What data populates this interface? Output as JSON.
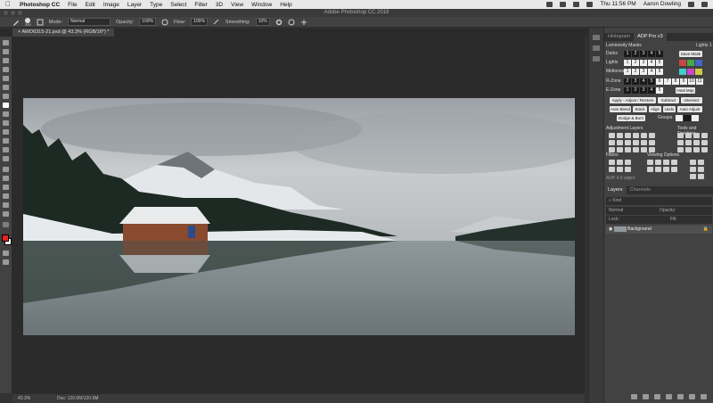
{
  "menubar": {
    "items": [
      "Photoshop CC",
      "File",
      "Edit",
      "Image",
      "Layer",
      "Type",
      "Select",
      "Filter",
      "3D",
      "View",
      "Window",
      "Help"
    ],
    "clock": "Thu 11:56 PM",
    "user": "Aaron Dowling"
  },
  "window": {
    "title": "Adobe Photoshop CC 2018"
  },
  "options": {
    "brush_size": "300",
    "mode_label": "Mode:",
    "mode_value": "Normal",
    "opacity_label": "Opacity:",
    "opacity_value": "100%",
    "flow_label": "Flow:",
    "flow_value": "100%",
    "smoothing_label": "Smoothing:",
    "smoothing_value": "10%"
  },
  "document": {
    "tab": "AWD6315-21.psd @ 43.3% (RGB/16*) *",
    "zoom": "43.3%",
    "doc_info": "Doc: 120.5M/120.5M"
  },
  "panels": {
    "top_tabs": [
      "Histogram",
      "ADP Pro v3"
    ],
    "luminosity_title": "Luminosity Masks",
    "lights_label": "Lights 1",
    "rows": [
      {
        "label": "Darks",
        "nums": [
          "1",
          "2",
          "3",
          "4",
          "5"
        ]
      },
      {
        "label": "Lights",
        "nums": [
          "1",
          "2",
          "3",
          "4",
          "5"
        ]
      },
      {
        "label": "Midtones",
        "nums": [
          "1",
          "2",
          "3",
          "4",
          "5"
        ]
      },
      {
        "label": "R-Zone",
        "nums": [
          "2",
          "3",
          "4",
          "5",
          "6",
          "7",
          "8",
          "9",
          "10",
          "11"
        ]
      },
      {
        "label": "E-Zone",
        "nums": [
          "1",
          "2",
          "3",
          "4",
          "5"
        ]
      }
    ],
    "save_mask": "Save Mask",
    "heal_map": "Heal Map",
    "apply_row": [
      "Apply - Adjust / Restore",
      "Subtract",
      "Intersect"
    ],
    "blend_row": [
      "Auto Blend",
      "Stack",
      "Align",
      "Undo",
      "Auto Adjust"
    ],
    "dodge_burn": "Dodge & Burn",
    "groups": "Groups",
    "adjustment_layers": "Adjustment Layers",
    "tools_finishing": "Tools and Finishing",
    "filters": "Filters",
    "viewing_options": "Viewing Options",
    "adp_footer": "ADP 4.0 adpro",
    "layers_tabs": [
      "Layers",
      "Channels"
    ],
    "kind_label": "Kind",
    "blend_mode": "Normal",
    "opacity_label": "Opacity:",
    "lock_label": "Lock:",
    "fill_label": "Fill:",
    "layer_name": "Background"
  },
  "colors": {
    "foreground": "#e52222",
    "background": "#ffffff"
  }
}
